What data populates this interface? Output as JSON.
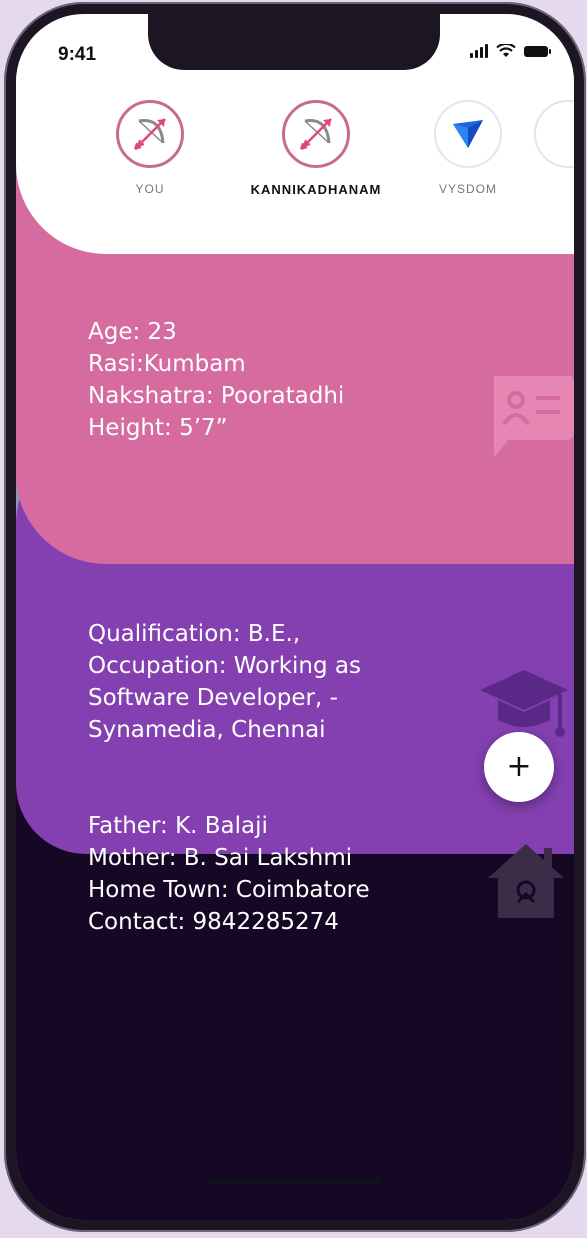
{
  "status_bar": {
    "time": "9:41"
  },
  "stories": [
    {
      "label": "YOU",
      "icon": "bow-arrow-icon"
    },
    {
      "label": "KANNIKADHANAM",
      "icon": "bow-arrow-icon"
    },
    {
      "label": "VYSDOM",
      "icon": "v-logo-icon"
    }
  ],
  "personal": {
    "lines": [
      "Age: 23",
      "Rasi:Kumbam",
      "Nakshatra: Pooratadhi",
      "Height: 5’7”"
    ],
    "icon": "id-card-icon"
  },
  "education": {
    "lines": [
      "Qualification: B.E.,",
      "Occupation: Working as",
      "Software Developer, -",
      "Synamedia, Chennai"
    ],
    "icon": "graduation-cap-icon"
  },
  "family": {
    "lines": [
      "Father: K. Balaji",
      "Mother: B. Sai Lakshmi",
      "Home Town: Coimbatore",
      "Contact: 9842285274"
    ],
    "icon": "home-icon"
  },
  "fab": {
    "label": "+"
  },
  "colors": {
    "pink": "#d56b9e",
    "purple": "#8440b1",
    "dark": "#160825",
    "bottom": "#8f97b8",
    "accent_ring": "#c86b92"
  }
}
